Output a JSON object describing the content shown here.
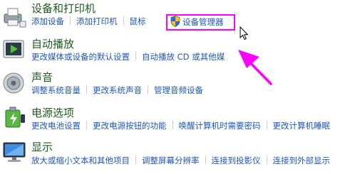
{
  "sections": [
    {
      "title": "设备和打印机",
      "icon": "printer-icon",
      "links": [
        "添加设备",
        "添加打印机",
        "鼠标"
      ],
      "highlighted_link": "设备管理器"
    },
    {
      "title": "自动播放",
      "icon": "autoplay-icon",
      "links": [
        "更改媒体或设备的默认设置",
        "自动播放 CD 或其他媒"
      ]
    },
    {
      "title": "声音",
      "icon": "speaker-icon",
      "links": [
        "调整系统音量",
        "更改系统声音",
        "管理音频设备"
      ]
    },
    {
      "title": "电源选项",
      "icon": "power-icon",
      "links": [
        "更改电池设置",
        "更改电源按钮的功能",
        "唤醒计算机时需要密码",
        "更改计算机睡眠"
      ]
    },
    {
      "title": "显示",
      "icon": "display-icon",
      "links": [
        "放大或缩小文本和其他项目",
        "调整屏幕分辨率",
        "连接到投影仪",
        "连接到外部显示"
      ]
    }
  ],
  "colors": {
    "title": "#1e5b1e",
    "link": "#1e57b5",
    "highlight": "#ff00ff"
  }
}
